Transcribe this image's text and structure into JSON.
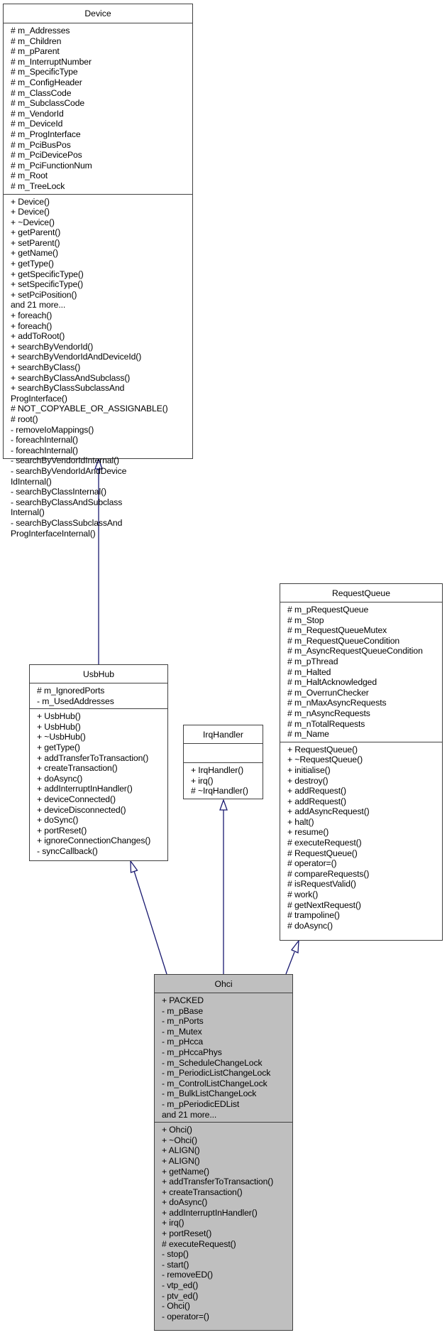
{
  "classes": {
    "device": {
      "name": "Device",
      "attributes": [
        "# m_Addresses",
        "# m_Children",
        "# m_pParent",
        "# m_InterruptNumber",
        "# m_SpecificType",
        "# m_ConfigHeader",
        "# m_ClassCode",
        "# m_SubclassCode",
        "# m_VendorId",
        "# m_DeviceId",
        "# m_ProgInterface",
        "# m_PciBusPos",
        "# m_PciDevicePos",
        "# m_PciFunctionNum",
        "# m_Root",
        "# m_TreeLock"
      ],
      "methods": [
        "+ Device()",
        "+ Device()",
        "+ ~Device()",
        "+ getParent()",
        "+ setParent()",
        "+ getName()",
        "+ getType()",
        "+ getSpecificType()",
        "+ setSpecificType()",
        "+ setPciPosition()",
        "and 21 more...",
        "+ foreach()",
        "+ foreach()",
        "+ addToRoot()",
        "+ searchByVendorId()",
        "+ searchByVendorIdAndDeviceId()",
        "+ searchByClass()",
        "+ searchByClassAndSubclass()",
        "+ searchByClassSubclassAnd",
        "ProgInterface()",
        "# NOT_COPYABLE_OR_ASSIGNABLE()",
        "# root()",
        "- removeIoMappings()",
        "- foreachInternal()",
        "- foreachInternal()",
        "- searchByVendorIdInternal()",
        "- searchByVendorIdAndDevice",
        "IdInternal()",
        "- searchByClassInternal()",
        "- searchByClassAndSubclass",
        "Internal()",
        "- searchByClassSubclassAnd",
        "ProgInterfaceInternal()"
      ]
    },
    "usbhub": {
      "name": "UsbHub",
      "attributes": [
        "# m_IgnoredPorts",
        "- m_UsedAddresses"
      ],
      "methods": [
        "+ UsbHub()",
        "+ UsbHub()",
        "+ ~UsbHub()",
        "+ getType()",
        "+ addTransferToTransaction()",
        "+ createTransaction()",
        "+ doAsync()",
        "+ addInterruptInHandler()",
        "+ deviceConnected()",
        "+ deviceDisconnected()",
        "+ doSync()",
        "+ portReset()",
        "+ ignoreConnectionChanges()",
        "- syncCallback()"
      ]
    },
    "irqhandler": {
      "name": "IrqHandler",
      "attributes": [],
      "methods": [
        "+ IrqHandler()",
        "+ irq()",
        "# ~IrqHandler()"
      ]
    },
    "requestqueue": {
      "name": "RequestQueue",
      "attributes": [
        "# m_pRequestQueue",
        "# m_Stop",
        "# m_RequestQueueMutex",
        "# m_RequestQueueCondition",
        "# m_AsyncRequestQueueCondition",
        "# m_pThread",
        "# m_Halted",
        "# m_HaltAcknowledged",
        "# m_OverrunChecker",
        "# m_nMaxAsyncRequests",
        "# m_nAsyncRequests",
        "# m_nTotalRequests",
        "# m_Name"
      ],
      "methods": [
        "+ RequestQueue()",
        "+ ~RequestQueue()",
        "+ initialise()",
        "+ destroy()",
        "+ addRequest()",
        "+ addRequest()",
        "+ addAsyncRequest()",
        "+ halt()",
        "+ resume()",
        "# executeRequest()",
        "# RequestQueue()",
        "# operator=()",
        "# compareRequests()",
        "# isRequestValid()",
        "# work()",
        "# getNextRequest()",
        "# trampoline()",
        "# doAsync()"
      ]
    },
    "ohci": {
      "name": "Ohci",
      "attributes": [
        "+ PACKED",
        "- m_pBase",
        "- m_nPorts",
        "- m_Mutex",
        "- m_pHcca",
        "- m_pHccaPhys",
        "- m_ScheduleChangeLock",
        "- m_PeriodicListChangeLock",
        "- m_ControlListChangeLock",
        "- m_BulkListChangeLock",
        "- m_pPeriodicEDList",
        "and 21 more..."
      ],
      "methods": [
        "+ Ohci()",
        "+ ~Ohci()",
        "+ ALIGN()",
        "+ ALIGN()",
        "+ getName()",
        "+ addTransferToTransaction()",
        "+ createTransaction()",
        "+ doAsync()",
        "+ addInterruptInHandler()",
        "+ irq()",
        "+ portReset()",
        "# executeRequest()",
        "- stop()",
        "- start()",
        "- removeED()",
        "- vtp_ed()",
        "- ptv_ed()",
        "- Ohci()",
        "- operator=()"
      ]
    }
  },
  "inheritance": [
    {
      "child": "UsbHub",
      "parent": "Device"
    },
    {
      "child": "Ohci",
      "parent": "UsbHub"
    },
    {
      "child": "Ohci",
      "parent": "IrqHandler"
    },
    {
      "child": "Ohci",
      "parent": "RequestQueue"
    }
  ],
  "colors": {
    "edge": "#191970",
    "border": "#404040",
    "highlight_fill": "#bfbfbf"
  }
}
